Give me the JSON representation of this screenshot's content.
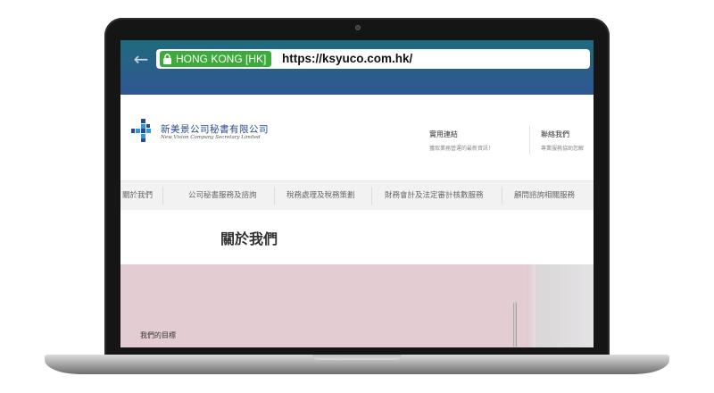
{
  "browser": {
    "ev_label": "HONG KONG [HK]",
    "url": "https://ksyuco.com.hk/",
    "back_glyph": "←"
  },
  "site": {
    "logo_cn": "新美景公司秘書有限公司",
    "logo_en": "New Vision Company Secretary Limited",
    "header_links": [
      {
        "title": "實用連結",
        "subtitle": "獲取業務營運的最新資訊！"
      },
      {
        "title": "聯絡我們",
        "subtitle": "專業服務協助您解"
      }
    ],
    "nav": [
      "關於我們",
      "公司秘書服務及諮詢",
      "稅務處理及稅務策劃",
      "財務會計及法定審計核數服務",
      "顧問諮詢相關服務"
    ],
    "page_title": "關於我們",
    "hero_label": "我們的目標"
  },
  "colors": {
    "browser_bar": "#2a5e8a",
    "ev_green": "#3cab3c",
    "logo_blue": "#2a4c8c",
    "hero_pink": "#e3cdd3"
  },
  "icons": {
    "back": "back-arrow-icon",
    "lock": "lock-icon",
    "logo": "logo-cross-icon"
  }
}
